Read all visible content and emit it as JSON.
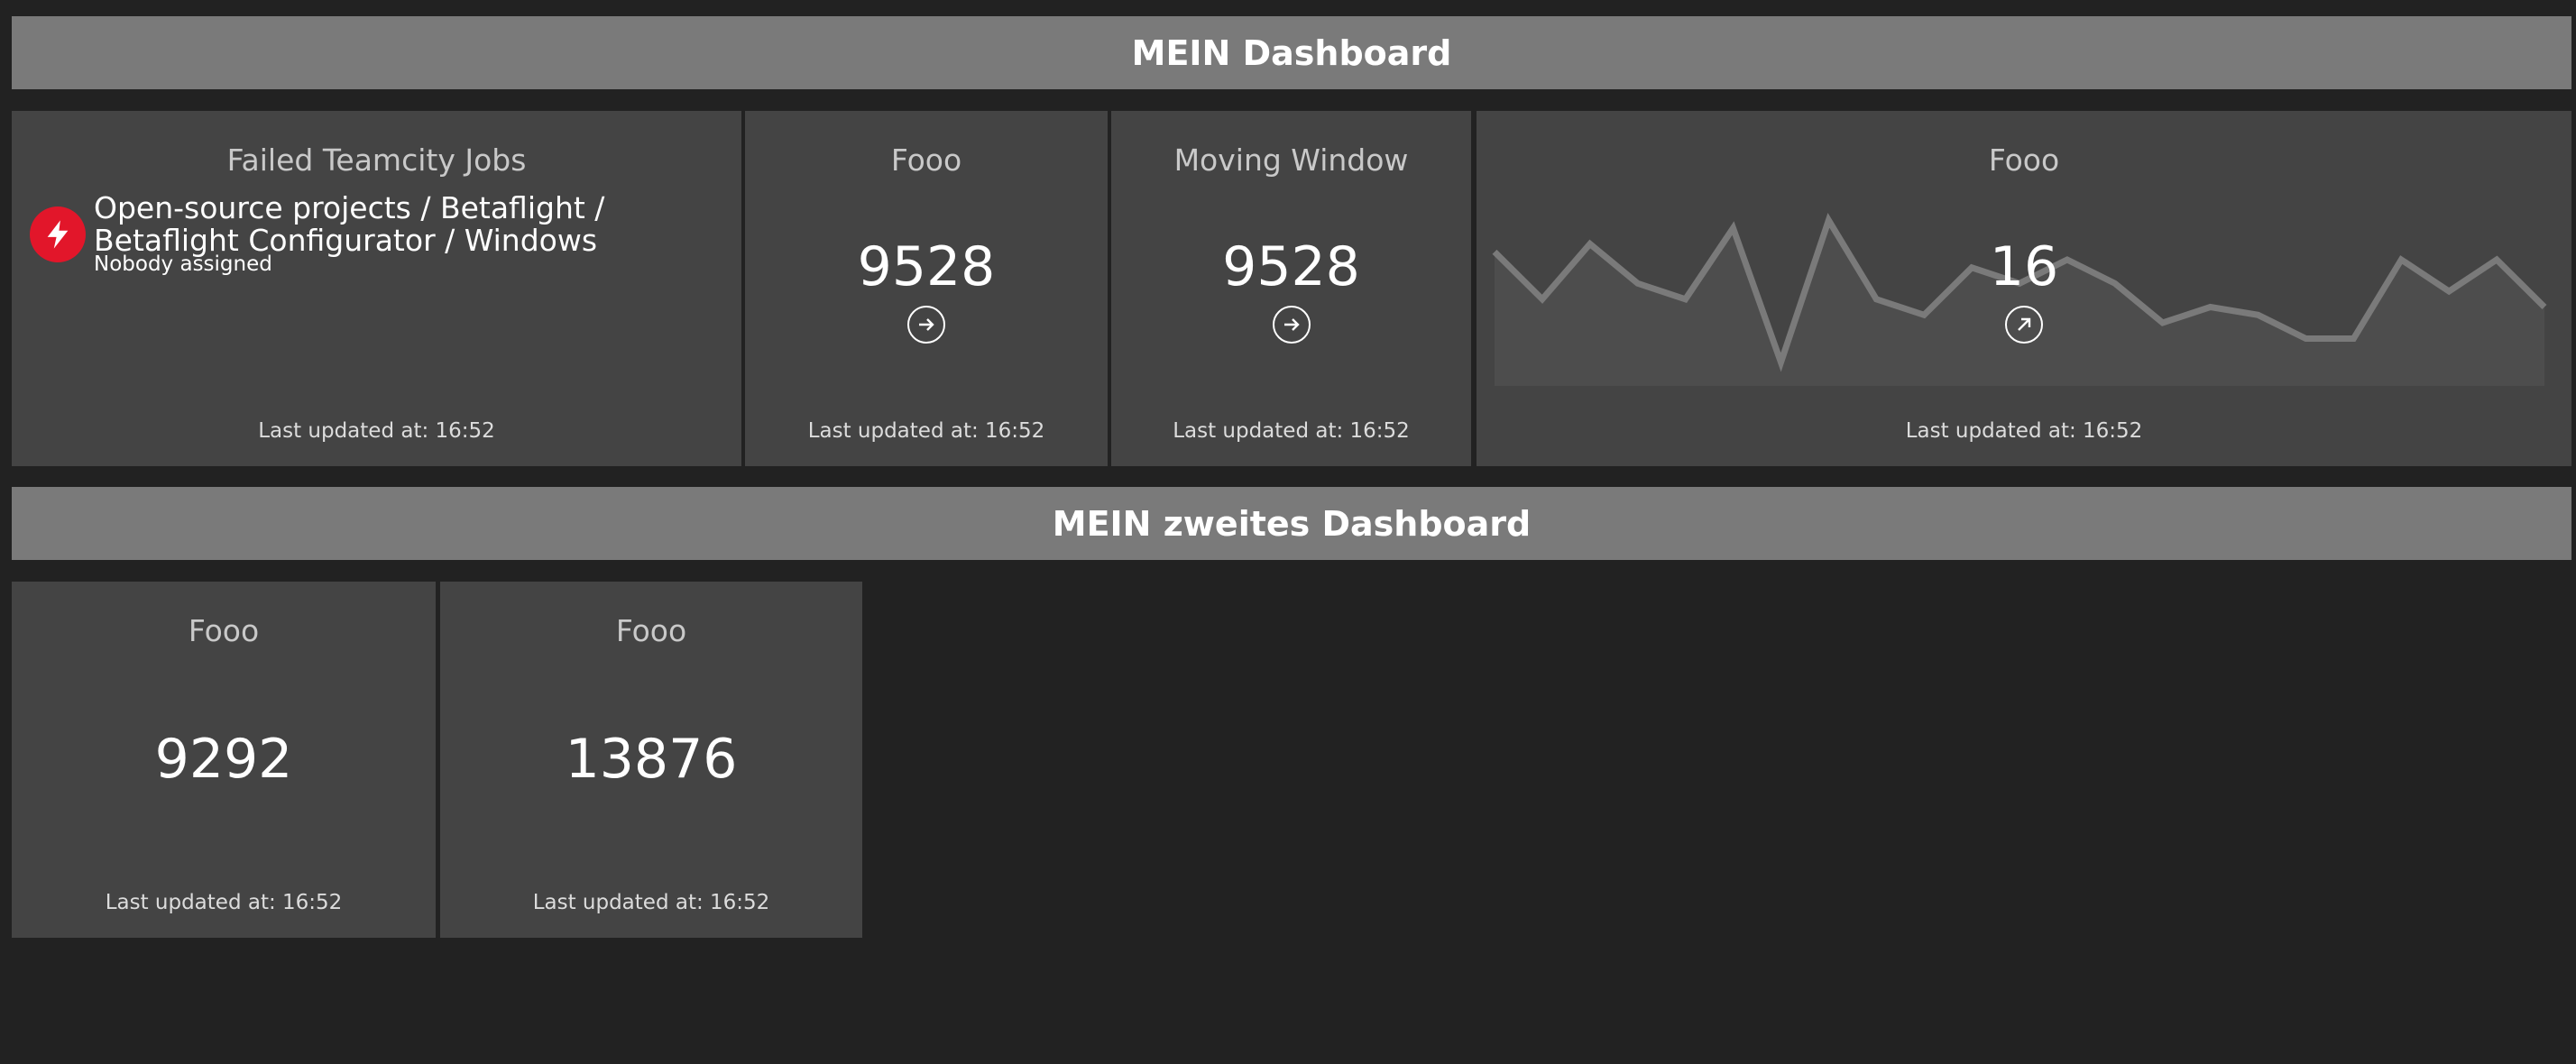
{
  "dashboards": [
    {
      "title": "MEIN Dashboard"
    },
    {
      "title": "MEIN zweites Dashboard"
    }
  ],
  "widgets": {
    "failed_jobs": {
      "title": "Failed Teamcity Jobs",
      "job_name": "Open-source projects / Betaflight / Betaflight Configurator / Windows",
      "assignee": "Nobody assigned",
      "icon": "lightning-bolt-icon",
      "updated": "Last updated at: 16:52",
      "status_color": "#e2162a"
    },
    "fooo_number": {
      "title": "Fooo",
      "value": "9528",
      "trend_icon": "arrow-right-icon",
      "updated": "Last updated at: 16:52"
    },
    "moving_window": {
      "title": "Moving Window",
      "value": "9528",
      "trend_icon": "arrow-right-icon",
      "updated": "Last updated at: 16:52"
    },
    "fooo_graph": {
      "title": "Fooo",
      "value": "16",
      "trend_icon": "arrow-up-right-icon",
      "updated": "Last updated at: 16:52"
    },
    "fooo_a": {
      "title": "Fooo",
      "value": "9292",
      "updated": "Last updated at: 16:52"
    },
    "fooo_b": {
      "title": "Fooo",
      "value": "13876",
      "updated": "Last updated at: 16:52"
    }
  },
  "chart_data": {
    "type": "area",
    "values": [
      17,
      11,
      18,
      13,
      11,
      20,
      3,
      21,
      11,
      9,
      15,
      13,
      16,
      13,
      8,
      10,
      9,
      6,
      6,
      16,
      12,
      16,
      10
    ],
    "ylim": [
      0,
      24
    ]
  }
}
